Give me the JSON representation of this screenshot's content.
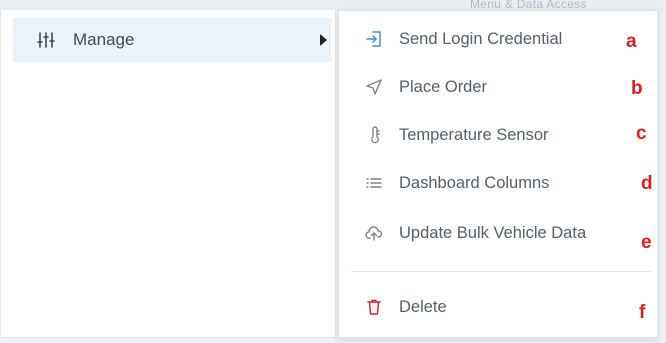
{
  "background": {
    "peek_text": "Menu & Data Access"
  },
  "left_menu": {
    "item": {
      "label": "Manage",
      "icon": "sliders-icon"
    }
  },
  "submenu": {
    "items": [
      {
        "label": "Send Login Credential",
        "icon": "login-icon",
        "marker": "a"
      },
      {
        "label": "Place Order",
        "icon": "send-arrow-icon",
        "marker": "b"
      },
      {
        "label": "Temperature Sensor",
        "icon": "thermometer-icon",
        "marker": "c"
      },
      {
        "label": "Dashboard Columns",
        "icon": "list-icon",
        "marker": "d"
      },
      {
        "label": "Update Bulk Vehicle Data",
        "icon": "cloud-upload-icon",
        "marker": "e"
      }
    ],
    "delete_item": {
      "label": "Delete",
      "icon": "trash-icon",
      "marker": "f"
    }
  },
  "colors": {
    "highlight": "#eaf3fb",
    "marker": "#e31b23",
    "delete_icon": "#e0242b",
    "text": "#56606b"
  }
}
